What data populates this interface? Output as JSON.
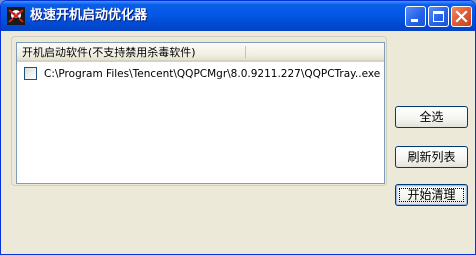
{
  "window": {
    "title": "极速开机启动优化器"
  },
  "list": {
    "header": "开机启动软件(不支持禁用杀毒软件)",
    "items": [
      {
        "checked": false,
        "text": "C:\\Program Files\\Tencent\\QQPCMgr\\8.0.9211.227\\QQPCTray..exe"
      }
    ]
  },
  "buttons": {
    "select_all": "全选",
    "refresh": "刷新列表",
    "start_clean": "开始清理"
  },
  "colors": {
    "titlebar": "#0458e6",
    "window_bg": "#ece9d8",
    "button_border": "#003c74"
  }
}
